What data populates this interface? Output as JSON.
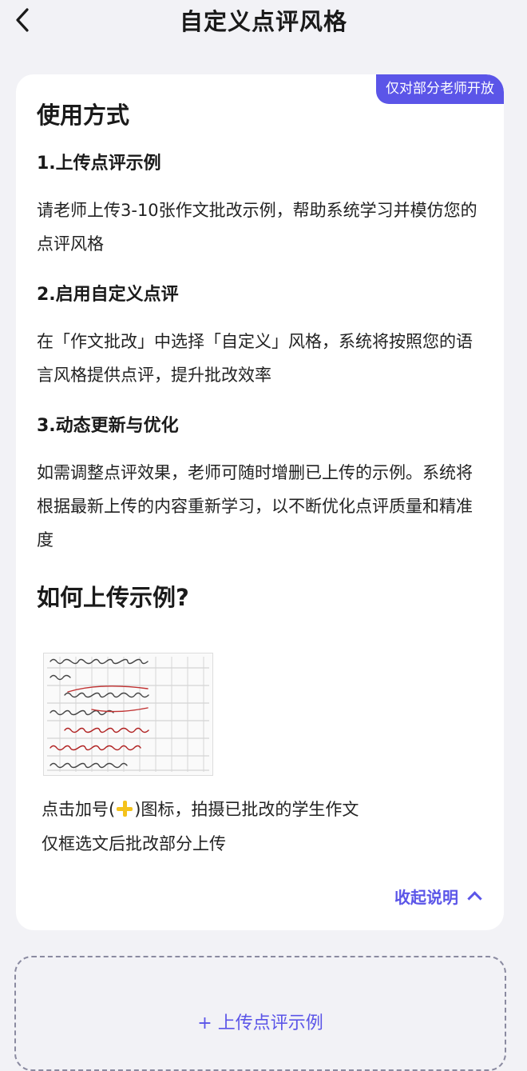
{
  "header": {
    "title": "自定义点评风格",
    "back_icon": "chevron-left-icon"
  },
  "card": {
    "badge": "仅对部分老师开放",
    "usage_title": "使用方式",
    "steps": [
      {
        "title": "1.上传点评示例",
        "text": " 请老师上传3-10张作文批改示例，帮助系统学习并模仿您的点评风格"
      },
      {
        "title": "2.启用自定义点评",
        "text": " 在「作文批改」中选择「自定义」风格，系统将按照您的语言风格提供点评，提升批改效率"
      },
      {
        "title": "3.动态更新与优化",
        "text": " 如需调整点评效果，老师可随时增删已上传的示例。系统将根据最新上传的内容重新学习，以不断优化点评质量和精准度"
      }
    ],
    "howto_title": "如何上传示例?",
    "howto_line1_pre": "点击加号(",
    "howto_line1_post": ")图标，拍摄已批改的学生作文",
    "howto_line2": "仅框选文后批改部分上传",
    "collapse_label": "收起说明"
  },
  "upload": {
    "label": "+ 上传点评示例"
  },
  "colors": {
    "accent": "#5b55e8",
    "plus_icon": "#f4c21b",
    "background": "#f2f2f6"
  }
}
